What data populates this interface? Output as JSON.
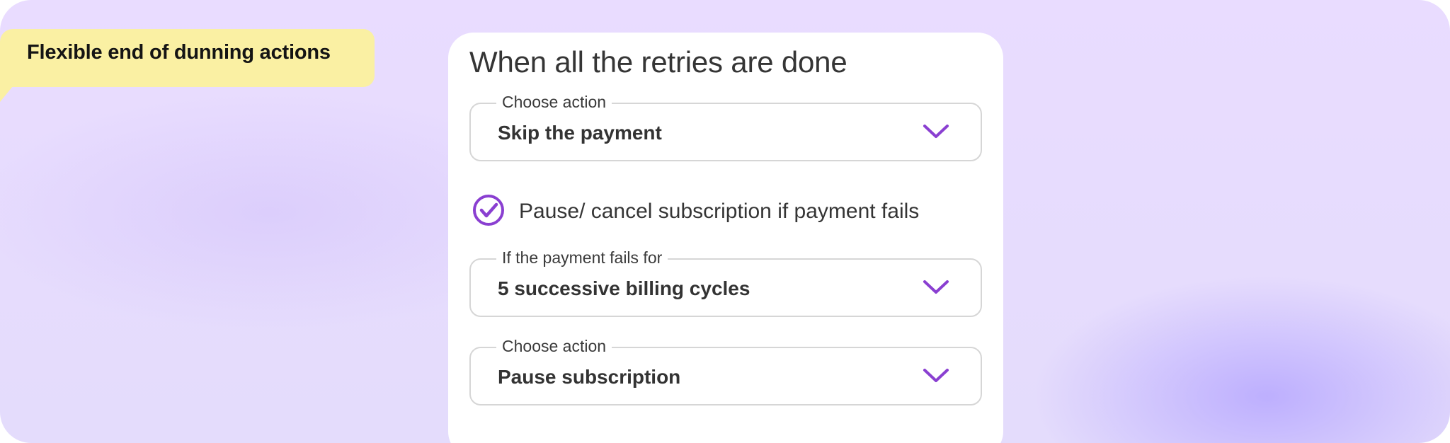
{
  "tag": {
    "label": "Flexible end of dunning actions"
  },
  "card": {
    "title": "When all the retries are done",
    "action_select": {
      "legend": "Choose action",
      "value": "Skip the payment"
    },
    "pause_checkbox": {
      "label": "Pause/ cancel subscription if payment fails",
      "checked": true
    },
    "fails_select": {
      "legend": "If the payment fails for",
      "value": "5 successive billing cycles"
    },
    "final_action_select": {
      "legend": "Choose action",
      "value": "Pause subscription"
    }
  },
  "colors": {
    "accent": "#8a3fd1",
    "tag_bg": "#faf0a3",
    "background": "#e7dcfd"
  }
}
